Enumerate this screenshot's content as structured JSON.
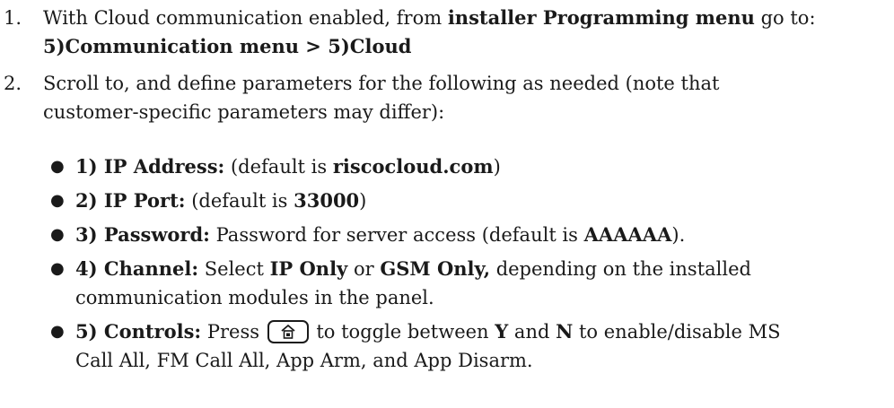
{
  "steps": [
    {
      "num": "1.",
      "t1": "With Cloud communication enabled, from ",
      "b1": "installer Programming menu",
      "t2": " go to:",
      "b2": "5)Communication menu > 5)Cloud"
    },
    {
      "num": "2.",
      "line1": "Scroll to, and define parameters for the following as needed (note that",
      "line2": "customer-specific parameters may differ):"
    }
  ],
  "bullets": [
    {
      "label": "1) IP Address:",
      "t1": " (default is ",
      "v1": "riscocloud.com",
      "t2": ")"
    },
    {
      "label": "2) IP Port:",
      "t1": " (default is ",
      "v1": "33000",
      "t2": ")"
    },
    {
      "label": "3) Password:",
      "t1": "  Password for server access (default is ",
      "v1": "AAAAAA",
      "t2": ")."
    },
    {
      "label": "4) Channel:",
      "t1": " Select ",
      "v1": "IP Only",
      "t2": " or ",
      "v2": "GSM Only,",
      "t3": " depending on the installed",
      "t4": "communication modules in the panel."
    },
    {
      "label": "5) Controls:",
      "t1": "  Press ",
      "t2": " to toggle between ",
      "v1": "Y",
      "t3": " and ",
      "v2": "N",
      "t4": " to enable/disable MS",
      "t5": "Call All, FM Call All, App Arm, and App Disarm."
    }
  ],
  "icons": {
    "key": "home-key-icon"
  }
}
